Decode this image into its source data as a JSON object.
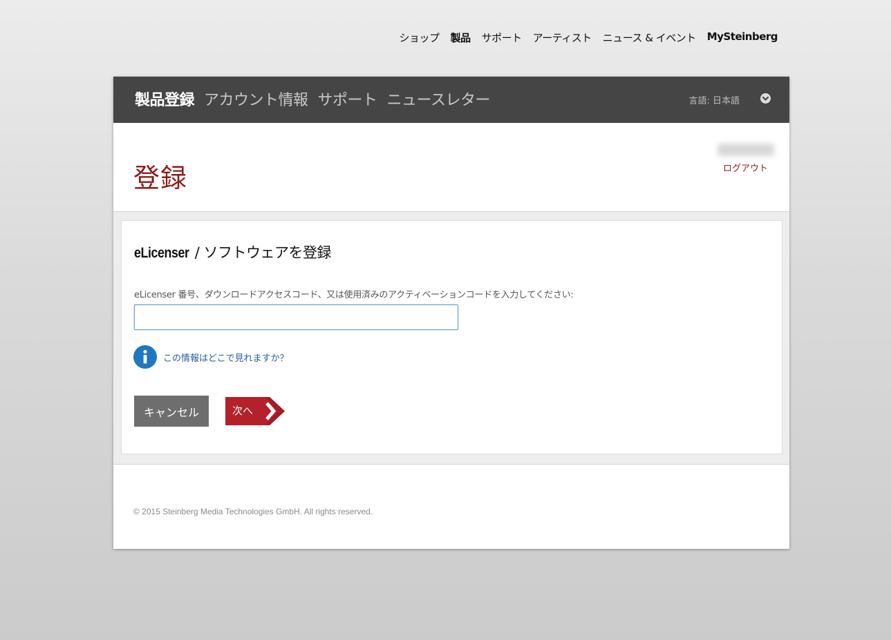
{
  "top_nav": {
    "items": [
      "ショップ",
      "製品",
      "サポート",
      "アーティスト",
      "ニュース & イベント",
      "MySteinberg"
    ]
  },
  "header": {
    "tabs": [
      "製品登録",
      "アカウント情報",
      "サポート",
      "ニュースレター"
    ],
    "language_label": "言語: 日本語",
    "language_toggle_icon": "chevron-down-icon"
  },
  "page": {
    "title": "登録",
    "logout": "ログアウト"
  },
  "form": {
    "heading_brand": "eLicenser",
    "heading_rest": " / ソフトウェアを登録",
    "field_label": "eLicenser 番号、ダウンロードアクセスコード、又は使用済みのアクティベーションコードを入力してください:",
    "input_value": "",
    "info_icon": "info-icon",
    "info_link": "この情報はどこで見れますか？",
    "cancel_label": "キャンセル",
    "next_label": "次へ"
  },
  "footer": {
    "copyright": "© 2015 Steinberg Media Technologies GmbH. All rights reserved."
  },
  "colors": {
    "accent_red": "#8e1b1b",
    "next_button": "#b5212a",
    "header_bar": "#454545",
    "link_blue": "#2a5e9c",
    "info_blue": "#1f77bf"
  }
}
